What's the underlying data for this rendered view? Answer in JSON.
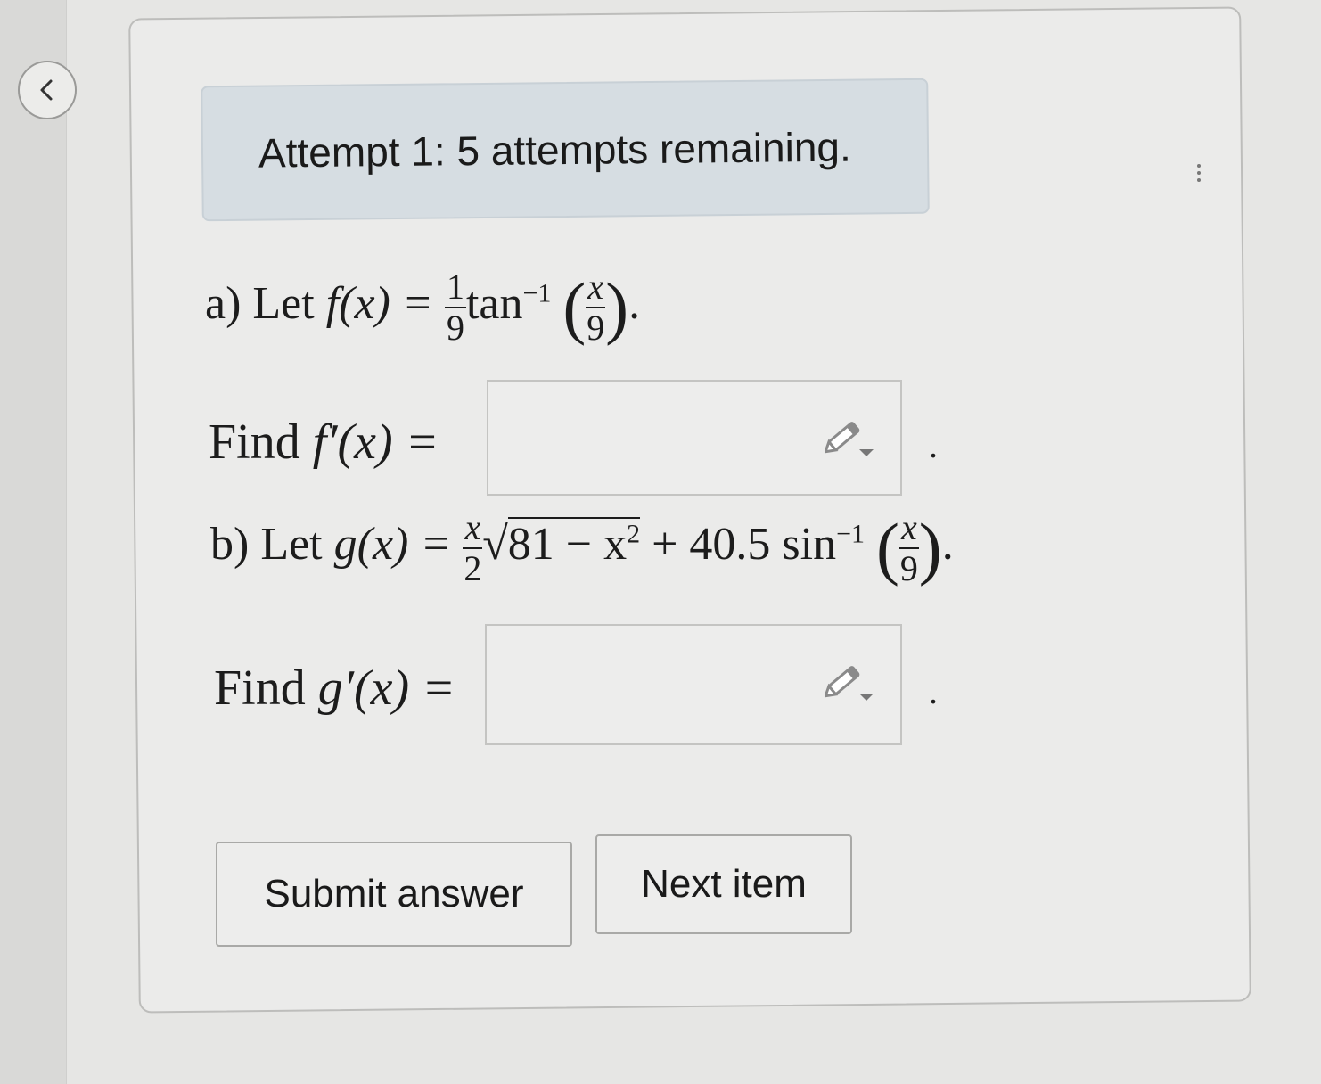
{
  "header": {
    "attempt_text": "Attempt 1: 5 attempts remaining."
  },
  "icons": {
    "back": "chevron-left-icon",
    "pencil": "pencil-dropdown-icon"
  },
  "question_a": {
    "label": "a)",
    "let_word": "Let",
    "lhs": "f(x) =",
    "coef_num": "1",
    "coef_den": "9",
    "func": "tan",
    "exponent": "−1",
    "arg_num": "x",
    "arg_den": "9",
    "trailing": ".",
    "find_word": "Find",
    "find_lhs": "f′(x) =",
    "find_trailing": ".",
    "answer_value": ""
  },
  "question_b": {
    "label": "b)",
    "let_word": "Let",
    "lhs": "g(x) =",
    "coef_num": "x",
    "coef_den": "2",
    "sqrt_sym": "√",
    "sqrt_body": "81 − x",
    "sqrt_exp": "2",
    "plus_term": "+ 40.5 sin",
    "exponent": "−1",
    "arg_num": "x",
    "arg_den": "9",
    "trailing": ".",
    "find_word": "Find",
    "find_lhs": "g′(x) =",
    "find_trailing": ".",
    "answer_value": ""
  },
  "buttons": {
    "submit": "Submit answer",
    "next": "Next item"
  }
}
